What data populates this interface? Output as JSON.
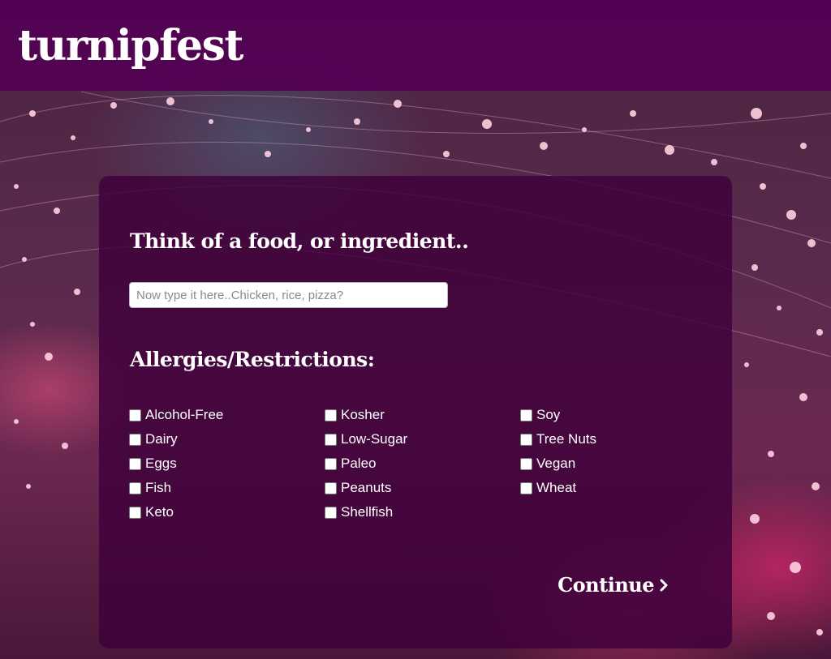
{
  "header": {
    "logo": "turnipfest"
  },
  "form": {
    "prompt_heading": "Think of a food, or ingredient..",
    "food_input": {
      "value": "",
      "placeholder": "Now type it here..Chicken, rice, pizza?"
    },
    "allergies_heading": "Allergies/Restrictions:",
    "options": [
      [
        "Alcohol-Free",
        "Dairy",
        "Eggs",
        "Fish",
        "Keto"
      ],
      [
        "Kosher",
        "Low-Sugar",
        "Paleo",
        "Peanuts",
        "Shellfish"
      ],
      [
        "Soy",
        "Tree Nuts",
        "Vegan",
        "Wheat"
      ]
    ],
    "continue_label": "Continue",
    "continue_icon": "chevron-right-icon"
  },
  "colors": {
    "header_bg": "#520054",
    "panel_bg": "#3e003a",
    "text": "#ffffff"
  }
}
